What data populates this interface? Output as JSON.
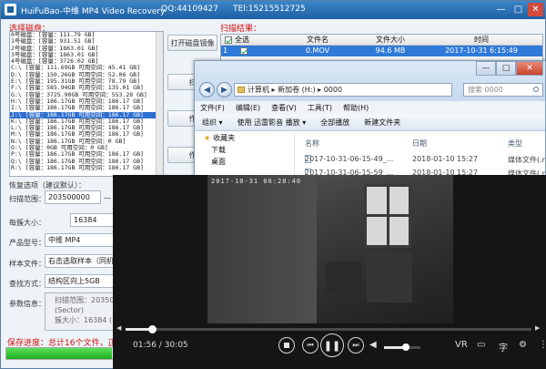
{
  "app": {
    "title": "HuiFuBao-中维 MP4 Video Recovery",
    "qq": "QQ:44109427",
    "tel": "TEl:15215512725",
    "min_label": "—",
    "max_label": "□",
    "close_label": "✕"
  },
  "disks": {
    "label": "选择磁盘：",
    "rows": [
      "0号磁盘：[容量：111.79 GB]",
      "1号磁盘：[容量：931.51 GB]",
      "2号磁盘：[容量：1863.01 GB]",
      "3号磁盘：[容量：1863.01 GB]",
      "4号磁盘：[容量：3726.02 GB]",
      "C:\\ [容量：111.69GB 可用空间：45.41 GB]",
      "D:\\ [容量：150.26GB 可用空间：52.06 GB]",
      "E:\\ [容量：195.31GB 可用空间：78.79 GB]",
      "F:\\ [容量：585.94GB 可用空间：135.01 GB]",
      "G:\\ [容量：3725.90GB 可用空间：553.28 GB]",
      "H:\\ [容量：186.17GB 可用空间：186.17 GB]",
      "I:\\ [容量：186.17GB 可用空间：186.17 GB]",
      "J:\\ [容量：186.17GB 可用空间：186.17 GB]",
      "K:\\ [容量：186.17GB 可用空间：186.17 GB]",
      "L:\\ [容量：186.17GB 可用空间：186.17 GB]",
      "M:\\ [容量：186.17GB 可用空间：186.17 GB]",
      "N:\\ [容量：186.17GB 可用空间：0 GB]",
      "O:\\ [容量：0GB 可用空间：0 GB]",
      "P:\\ [容量：186.17GB 可用空间：186.17 GB]",
      "Q:\\ [容量：186.17GB 可用空间：186.17 GB]",
      "R:\\ [容量：186.17GB 可用空间：186.17 GB]"
    ],
    "selected_index": 12
  },
  "buttons": {
    "open_disk": "打开磁盘镜像",
    "b2": "扫",
    "b3": "作",
    "b4": "作"
  },
  "results": {
    "label": "扫描结果：",
    "headers": {
      "all": "全选",
      "name": "文件名",
      "size": "文件大小",
      "time": "时间"
    },
    "rows": [
      {
        "num": "1",
        "name": "0.MOV",
        "size": "94.6 MB",
        "time": "2017-10-31 6:15:49",
        "checked": true
      }
    ]
  },
  "form": {
    "scan_range_title": "恢复选项（建议默认）：",
    "scan_range_label": "扫描范围：",
    "scan_start": "203500000",
    "scan_dash": "—",
    "scan_end": "390",
    "cluster_label": "每簇大小：",
    "cluster_value": "16384",
    "brand_label": "产品型号：",
    "brand_value": "中维 MP4",
    "sample_label": "样本文件：",
    "sample_value": "右击选取样本（同机器",
    "search_label": "查找方式：",
    "search_value": "结构区向上5GB",
    "params_label": "参数信息：",
    "params_line1": "扫描范围：203500000",
    "params_line2": "(Sector)",
    "params_line3": "簇大小：16384 (Byt"
  },
  "progress": {
    "label": "保存进度：总计16个文件，正在保",
    "fraction": 0.98
  },
  "explorer": {
    "path": "计算机 ▸ 新加卷 (H:) ▸ 0000",
    "search_placeholder": "搜索 0000",
    "menus": [
      "文件(F)",
      "编辑(E)",
      "查看(V)",
      "工具(T)",
      "帮助(H)"
    ],
    "toolbar": [
      "组织 ▾",
      "使用 迅雷影音 播放 ▾",
      "全部播放",
      "新建文件夹"
    ],
    "nav": [
      "收藏夹",
      "下载",
      "桌面"
    ],
    "columns": {
      "name": "名称",
      "date": "日期",
      "type": "类型"
    },
    "files": [
      {
        "name": "2017-10-31-06-15-49_...",
        "date": "2018-01-10 15:27",
        "type": "媒体文件(.m"
      },
      {
        "name": "2017-10-31-06-15-59_...",
        "date": "2018-01-10 15:27",
        "type": "媒体文件(.m"
      }
    ]
  },
  "player": {
    "overlay_timestamp": "2017-10-31 06:20:40",
    "current_time": "01:56",
    "total_time": "30:05",
    "time_sep": " / ",
    "progress_fraction": 0.065,
    "volume_fraction": 0.6,
    "vr_label": "VR",
    "subtitle_label": "字"
  }
}
